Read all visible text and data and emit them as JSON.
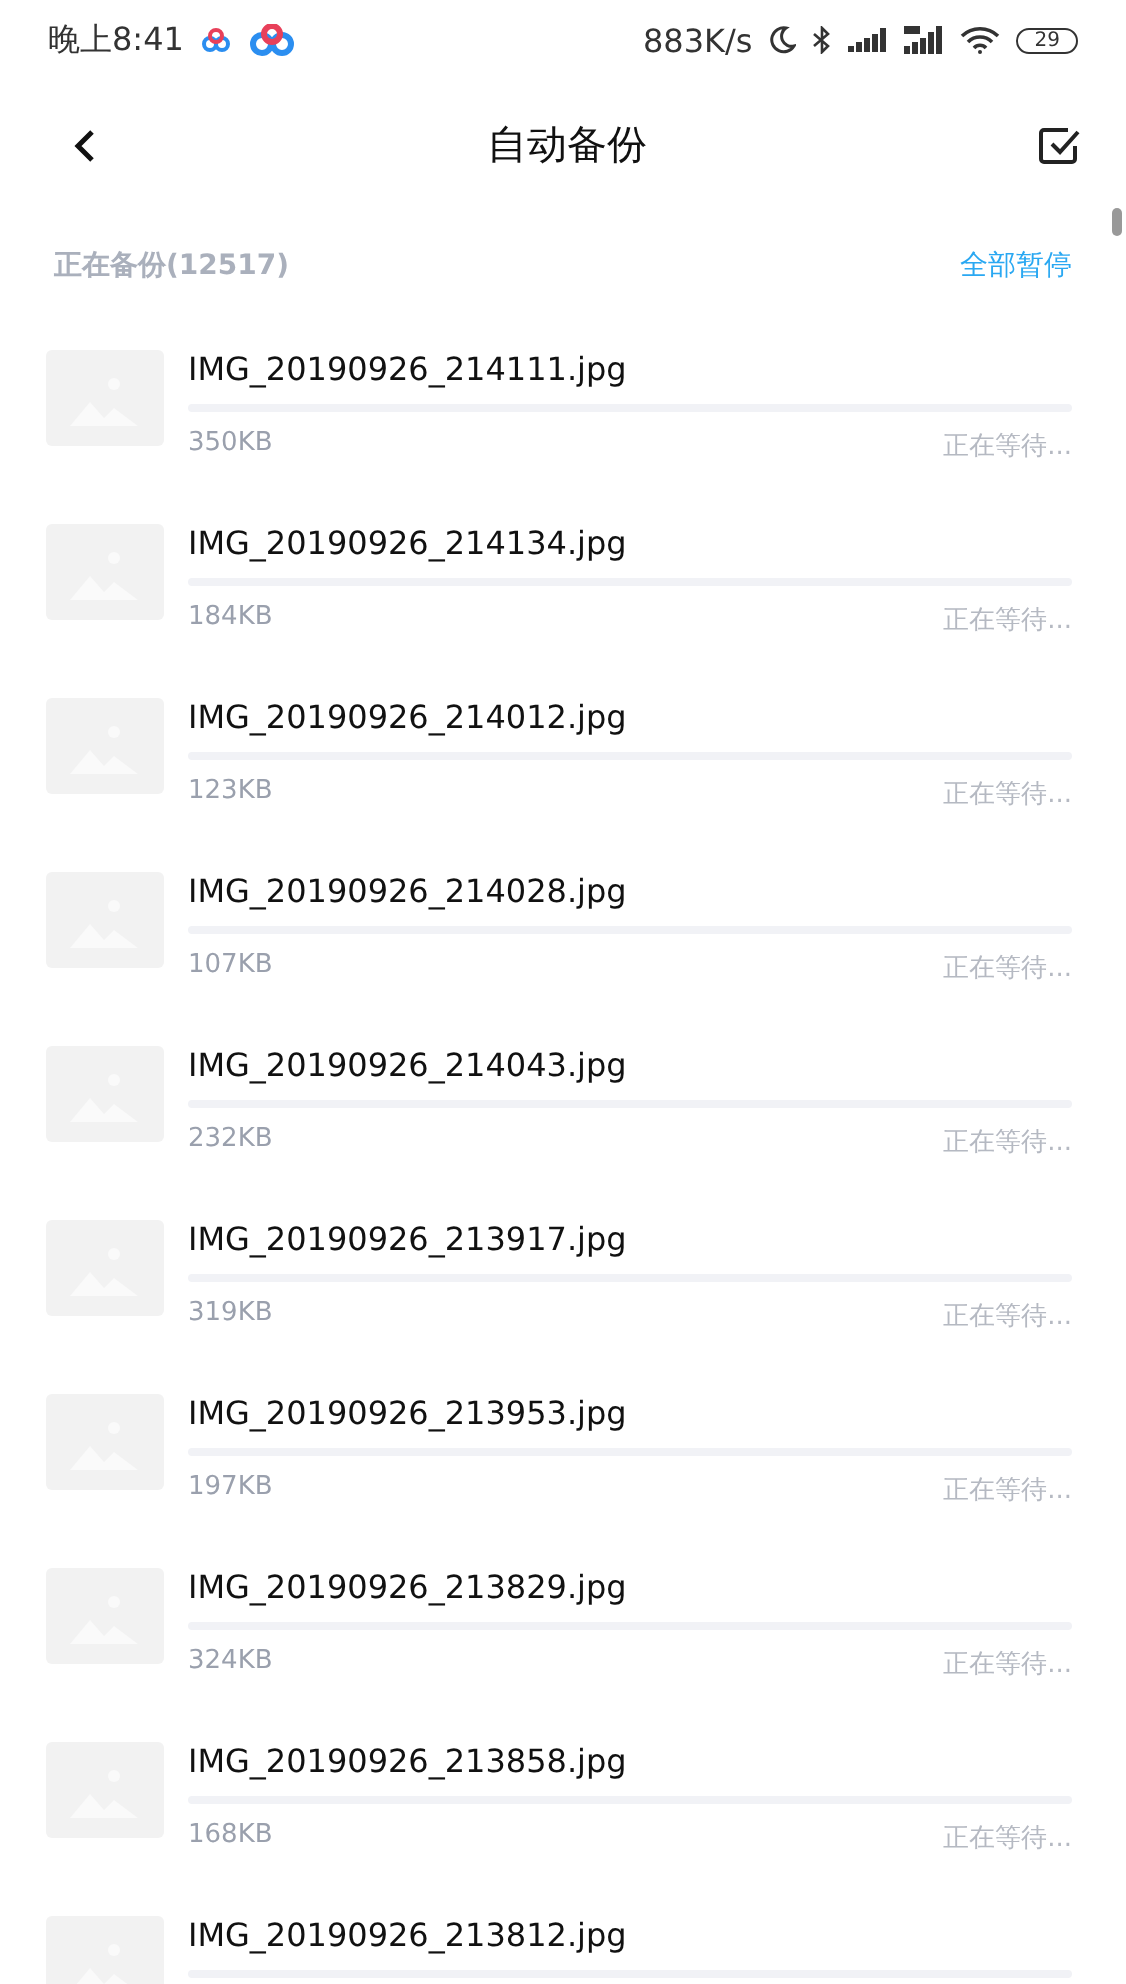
{
  "status_bar": {
    "time": "晚上8:41",
    "speed": "883K/s",
    "battery": "29"
  },
  "header": {
    "title": "自动备份"
  },
  "section": {
    "title": "正在备份(12517)",
    "action": "全部暂停"
  },
  "files": [
    {
      "name": "IMG_20190926_214111.jpg",
      "size": "350KB",
      "status": "正在等待...",
      "level": 0
    },
    {
      "name": "IMG_20190926_214134.jpg",
      "size": "184KB",
      "status": "正在等待...",
      "level": 0
    },
    {
      "name": "IMG_20190926_214012.jpg",
      "size": "123KB",
      "status": "正在等待...",
      "level": 0
    },
    {
      "name": "IMG_20190926_214028.jpg",
      "size": "107KB",
      "status": "正在等待...",
      "level": 0
    },
    {
      "name": "IMG_20190926_214043.jpg",
      "size": "232KB",
      "status": "正在等待...",
      "level": 0
    },
    {
      "name": "IMG_20190926_213917.jpg",
      "size": "319KB",
      "status": "正在等待...",
      "level": 0
    },
    {
      "name": "IMG_20190926_213953.jpg",
      "size": "197KB",
      "status": "正在等待...",
      "level": 0
    },
    {
      "name": "IMG_20190926_213829.jpg",
      "size": "324KB",
      "status": "正在等待...",
      "level": 0
    },
    {
      "name": "IMG_20190926_213858.jpg",
      "size": "168KB",
      "status": "正在等待...",
      "level": 0
    },
    {
      "name": "IMG_20190926_213812.jpg",
      "level": 0
    }
  ]
}
